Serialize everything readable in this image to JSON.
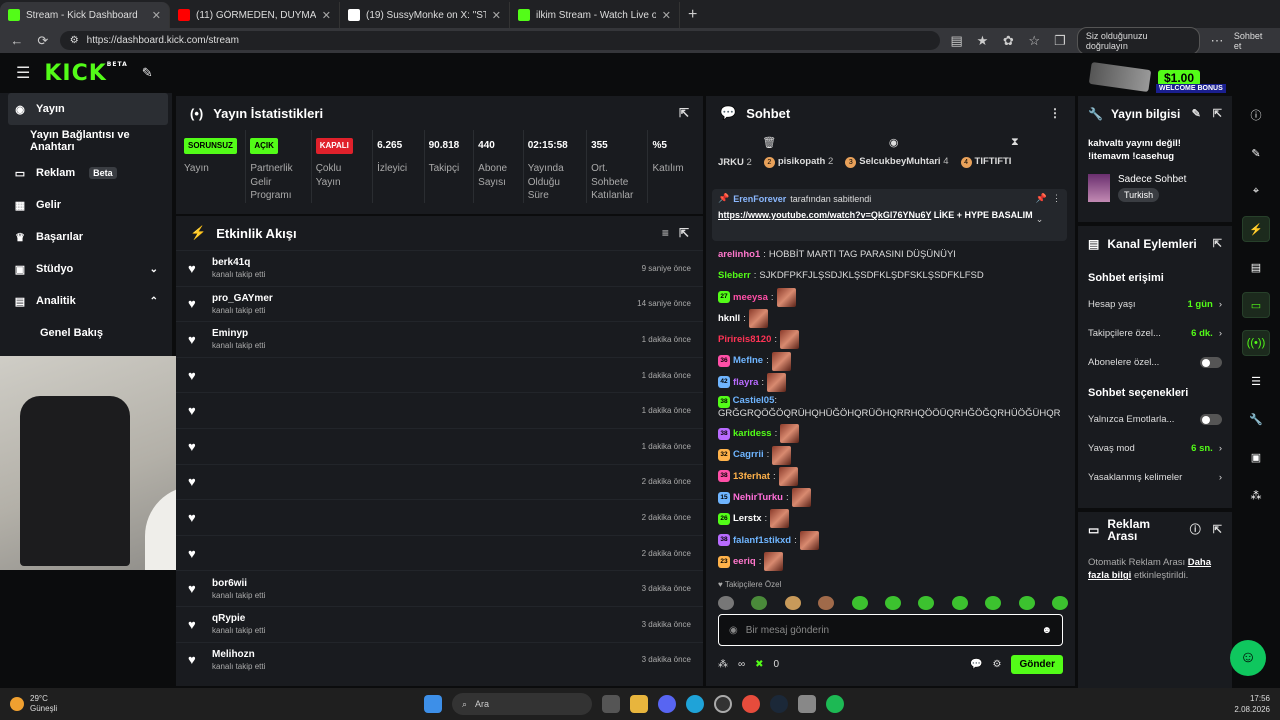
{
  "browser": {
    "tabs": [
      {
        "title": "Stream - Kick Dashboard",
        "color": "#53fc18",
        "active": true
      },
      {
        "title": "(11) GÖRMEDEN, DUYMADAN VE",
        "color": "#ff0000"
      },
      {
        "title": "(19) SussyMonke on X: \"STEAM YE",
        "color": "#ffffff"
      },
      {
        "title": "ilkim Stream - Watch Live on Kick",
        "color": "#53fc18"
      }
    ],
    "url": "https://dashboard.kick.com/stream",
    "verify_label": "Siz olduğunuzu doğrulayın",
    "copilot_label": "Sohbet et"
  },
  "kick": {
    "logo": "KICK",
    "logo_sup": "BETA"
  },
  "promo": {
    "amount": "$1.00",
    "label": "WELCOME BONUS"
  },
  "sidebar": {
    "items": [
      {
        "label": "Yayın",
        "selected": true,
        "icon": "broadcast-icon"
      },
      {
        "label": "Yayın Bağlantısı ve Anahtarı"
      },
      {
        "label": "Reklam",
        "badge": "Beta",
        "icon": "ad-icon"
      },
      {
        "label": "Gelir",
        "icon": "revenue-icon"
      },
      {
        "label": "Başarılar",
        "icon": "trophy-icon"
      },
      {
        "label": "Stüdyo",
        "icon": "studio-icon",
        "chevron": "down"
      },
      {
        "label": "Analitik",
        "icon": "analytics-icon",
        "chevron": "up"
      },
      {
        "label": "Genel Bakış"
      }
    ]
  },
  "stats": {
    "title": "Yayın İstatistikleri",
    "items": [
      {
        "chip": "SORUNSUZ",
        "chip_color": "green",
        "label": "Yayın"
      },
      {
        "chip": "AÇIK",
        "chip_color": "green",
        "label": "Partnerlik Gelir Programı"
      },
      {
        "chip": "KAPALI",
        "chip_color": "red",
        "label": "Çoklu Yayın"
      },
      {
        "value": "6.265",
        "label": "İzleyici"
      },
      {
        "value": "90.818",
        "label": "Takipçi"
      },
      {
        "value": "440",
        "label": "Abone Sayısı"
      },
      {
        "value": "02:15:58",
        "label": "Yayında Olduğu Süre"
      },
      {
        "value": "355",
        "label": "Ort. Sohbete Katılanlar"
      },
      {
        "value": "%5",
        "label": "Katılım"
      }
    ]
  },
  "activity": {
    "title": "Etkinlik Akışı",
    "rows": [
      {
        "user": "berk41q",
        "sub": "kanalı takip etti",
        "time": "9 saniye önce"
      },
      {
        "user": "pro_GAYmer",
        "sub": "kanalı takip etti",
        "time": "14 saniye önce"
      },
      {
        "user": "Eminyp",
        "sub": "kanalı takip etti",
        "time": "1 dakika önce"
      },
      {
        "user": "",
        "sub": "",
        "time": "1 dakika önce"
      },
      {
        "user": "",
        "sub": "",
        "time": "1 dakika önce"
      },
      {
        "user": "",
        "sub": "",
        "time": "1 dakika önce"
      },
      {
        "user": "",
        "sub": "",
        "time": "2 dakika önce"
      },
      {
        "user": "",
        "sub": "",
        "time": "2 dakika önce"
      },
      {
        "user": "",
        "sub": "",
        "time": "2 dakika önce"
      },
      {
        "user": "bor6wii",
        "sub": "kanalı takip etti",
        "time": "3 dakika önce"
      },
      {
        "user": "qRypie",
        "sub": "kanalı takip etti",
        "time": "3 dakika önce"
      },
      {
        "user": "Melihozn",
        "sub": "kanalı takip etti",
        "time": "3 dakika önce"
      }
    ]
  },
  "chat": {
    "title": "Sohbet",
    "top_subs": [
      {
        "name": "JRKU",
        "n": "2"
      },
      {
        "name": "pisikopath",
        "n": "2"
      },
      {
        "name": "SelcukbeyMuhtari",
        "n": "4"
      },
      {
        "name": "TIFTIFTI",
        "n": ""
      }
    ],
    "pinned": {
      "by": "ErenForever",
      "by_suffix": "tarafından sabitlendi",
      "link": "https://www.youtube.com/watch?v=QkGl76YNu6Y",
      "text": " LİKE + HYPE BASALIM"
    },
    "messages": [
      {
        "badge": "",
        "name": "arelinho1",
        "color": "#ff77cc",
        "text": "HOBBİT MARTI TAG PARASINI DÜŞÜNÜYI",
        "emote": false
      },
      {
        "badge": "",
        "name": "Sleberr",
        "color": "#53fc18",
        "text": "SJKDFPKFJLŞSDJKLŞSDFKLŞDFSKLŞSDFKLFSD",
        "emote": false
      },
      {
        "badge": "27",
        "name": "meeysa",
        "color": "#ff4fa7",
        "text": "",
        "emote": true
      },
      {
        "badge": "",
        "name": "hknll",
        "color": "#ffffff",
        "text": "",
        "emote": true
      },
      {
        "badge": "",
        "name": "Pirireis8120",
        "color": "#ff3355",
        "text": "",
        "emote": true
      },
      {
        "badge": "36",
        "name": "Meflne",
        "color": "#6fb5ff",
        "text": "",
        "emote": true
      },
      {
        "badge": "42",
        "name": "flayra",
        "color": "#b96bff",
        "text": "",
        "emote": true
      },
      {
        "badge": "38",
        "name": "Castiel05",
        "color": "#6fb5ff",
        "text": "GRĞGRQÖĞÖQRÜHQHÜĞÖHQRÜÖHQRRHQÖÖÜQRHĞÖĞQRHÜÖĞÜHQR",
        "emote": false,
        "two": true
      },
      {
        "badge": "38",
        "name": "karidess",
        "color": "#53fc18",
        "text": "",
        "emote": true
      },
      {
        "badge": "32",
        "name": "Cagrrii",
        "color": "#6fb5ff",
        "text": "",
        "emote": true
      },
      {
        "badge": "38",
        "name": "13ferhat",
        "color": "#ffb24a",
        "text": "",
        "emote": true
      },
      {
        "badge": "15",
        "name": "NehirTurku",
        "color": "#ff6fd8",
        "text": "",
        "emote": true
      },
      {
        "badge": "26",
        "name": "Lerstx",
        "color": "#ffffff",
        "text": "",
        "emote": true
      },
      {
        "badge": "38",
        "name": "falanf1stikxd",
        "color": "#6fb5ff",
        "text": "",
        "emote": true
      },
      {
        "badge": "23",
        "name": "eeriq",
        "color": "#ff77cc",
        "text": "",
        "emote": true
      }
    ],
    "follower_note": "♥ Takipçilere Özel",
    "input_placeholder": "Bir mesaj gönderin",
    "infinity": "∞",
    "points": "0",
    "send_label": "Gönder"
  },
  "stream_info": {
    "title": "Yayın bilgisi",
    "description": "kahvaltı yayını değil! !itemavm !casehug",
    "category": "Sadece Sohbet",
    "tag": "Turkish"
  },
  "channel_actions": {
    "title": "Kanal Eylemleri",
    "access_title": "Sohbet erişimi",
    "rows": [
      {
        "label": "Hesap yaşı",
        "value": "1 gün",
        "type": "arrow"
      },
      {
        "label": "Takipçilere özel...",
        "value": "6 dk.",
        "type": "arrow"
      },
      {
        "label": "Abonelere özel...",
        "type": "toggle"
      }
    ],
    "options_title": "Sohbet seçenekleri",
    "rows2": [
      {
        "label": "Yalnızca Emotlarla...",
        "type": "toggle"
      },
      {
        "label": "Yavaş mod",
        "value": "6 sn.",
        "type": "arrow"
      },
      {
        "label": "Yasaklanmış kelimeler",
        "value": "",
        "type": "arrow"
      }
    ]
  },
  "ad_break": {
    "title": "Reklam Arası",
    "text1": "Otomatik Reklam Arası",
    "link": "Daha fazla bilgi",
    "text2": "etkinleştirildi."
  },
  "taskbar": {
    "temp": "29°C",
    "weather": "Güneşli",
    "search": "Ara",
    "time": "17:56",
    "date": "2.08.2026"
  }
}
